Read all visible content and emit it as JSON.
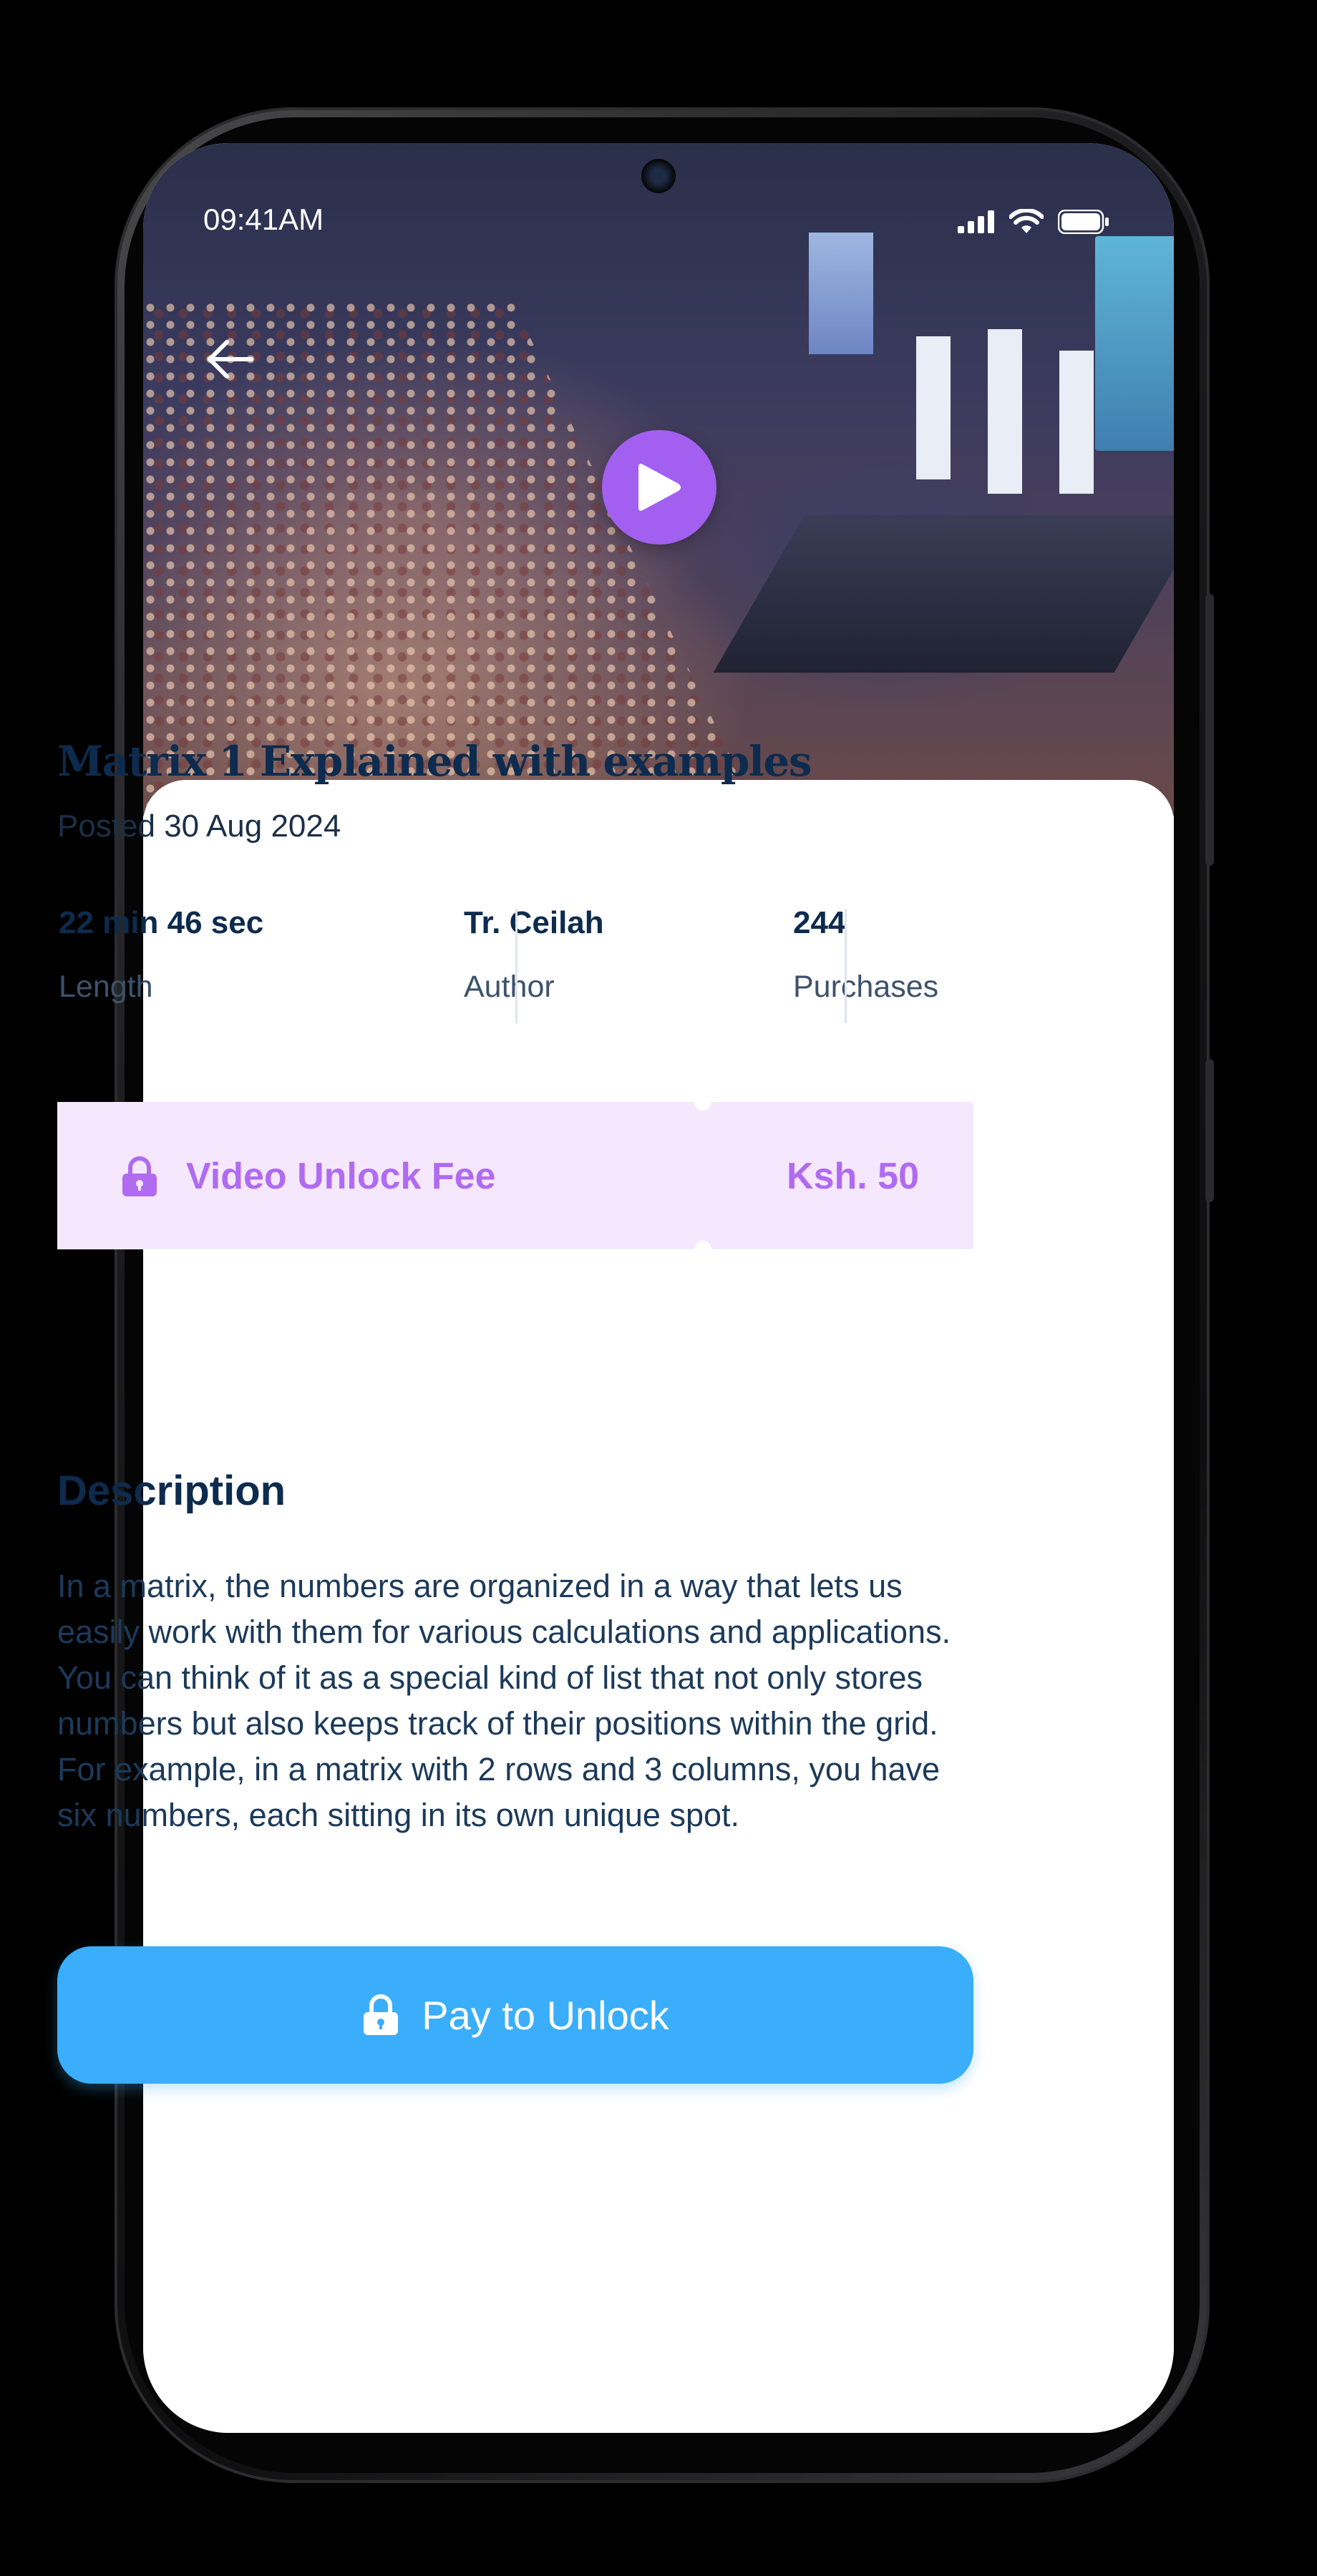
{
  "status_bar": {
    "time": "09:41AM"
  },
  "video": {
    "title": "Matrix 1 Explained with examples",
    "posted": "Posted 30 Aug 2024"
  },
  "stats": [
    {
      "value": "22 min 46 sec",
      "label": "Length"
    },
    {
      "value": "Tr. Ceilah",
      "label": "Author"
    },
    {
      "value": "244",
      "label": "Purchases"
    }
  ],
  "unlock_fee": {
    "label": "Video Unlock Fee",
    "price": "Ksh. 50"
  },
  "description": {
    "heading": "Description",
    "body": "In a matrix, the numbers are organized in a way that lets us easily work with them for various calculations and applications. You can think of it as a special kind of list that not only stores numbers but also keeps track of their positions within the grid. For example, in a matrix with 2 rows and 3 columns, you have six numbers, each sitting in its own unique spot."
  },
  "actions": {
    "pay_label": "Pay to Unlock"
  },
  "icons": {
    "back": "arrow-left-icon",
    "play": "play-icon",
    "lock": "lock-icon",
    "signal": "signal-icon",
    "wifi": "wifi-icon",
    "battery": "battery-icon"
  },
  "colors": {
    "primary_dark": "#0d2b4e",
    "accent_purple": "#a25ff0",
    "fee_bg": "#f5e8fe",
    "fee_text": "#b06bf0",
    "button_blue": "#3aaefb"
  }
}
